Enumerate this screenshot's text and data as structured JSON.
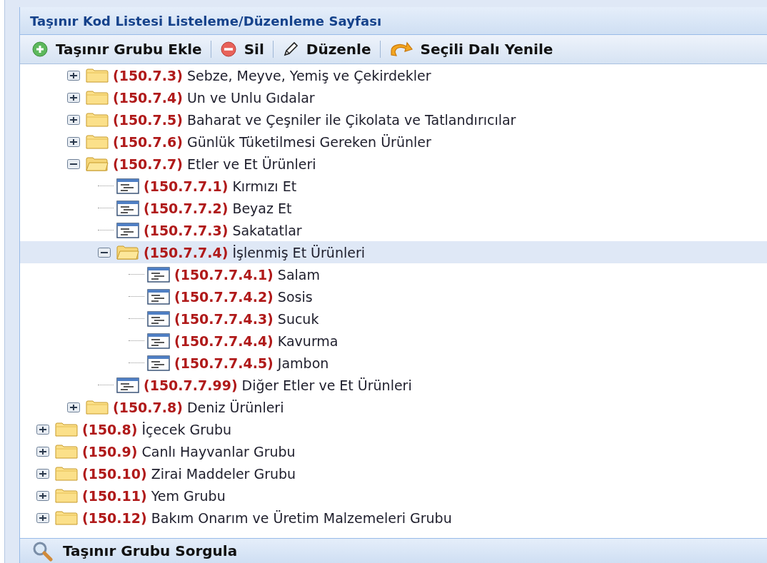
{
  "panel": {
    "title": "Taşınır Kod Listesi Listeleme/Düzenleme Sayfası"
  },
  "toolbar": [
    {
      "kind": "add",
      "label": "Taşınır Grubu Ekle"
    },
    {
      "kind": "delete",
      "label": "Sil"
    },
    {
      "kind": "edit",
      "label": "Düzenle"
    },
    {
      "kind": "refresh",
      "label": "Seçili Dalı Yenile"
    }
  ],
  "tree": {
    "items": [
      {
        "children": [
          {
            "kind": "folder",
            "code": "(150.7.3)",
            "label": "Sebze, Meyve, Yemiş ve Çekirdekler",
            "expanded": false,
            "selected": false
          },
          {
            "kind": "folder",
            "code": "(150.7.4)",
            "label": "Un ve Unlu Gıdalar",
            "expanded": false,
            "selected": false
          },
          {
            "kind": "folder",
            "code": "(150.7.5)",
            "label": "Baharat ve Çeşniler ile Çikolata ve Tatlandırıcılar",
            "expanded": false,
            "selected": false
          },
          {
            "kind": "folder",
            "code": "(150.7.6)",
            "label": "Günlük Tüketilmesi Gereken Ürünler",
            "expanded": false,
            "selected": false
          },
          {
            "kind": "folder",
            "code": "(150.7.7)",
            "label": "Etler ve Et Ürünleri",
            "expanded": true,
            "selected": false,
            "children": [
              {
                "kind": "leaf",
                "code": "(150.7.7.1)",
                "label": "Kırmızı Et",
                "selected": false
              },
              {
                "kind": "leaf",
                "code": "(150.7.7.2)",
                "label": "Beyaz Et",
                "selected": false
              },
              {
                "kind": "leaf",
                "code": "(150.7.7.3)",
                "label": "Sakatatlar",
                "selected": false
              },
              {
                "kind": "folder",
                "code": "(150.7.7.4)",
                "label": "İşlenmiş Et Ürünleri",
                "expanded": true,
                "selected": true,
                "children": [
                  {
                    "kind": "leaf",
                    "code": "(150.7.7.4.1)",
                    "label": "Salam",
                    "selected": false
                  },
                  {
                    "kind": "leaf",
                    "code": "(150.7.7.4.2)",
                    "label": "Sosis",
                    "selected": false
                  },
                  {
                    "kind": "leaf",
                    "code": "(150.7.7.4.3)",
                    "label": "Sucuk",
                    "selected": false
                  },
                  {
                    "kind": "leaf",
                    "code": "(150.7.7.4.4)",
                    "label": "Kavurma",
                    "selected": false
                  },
                  {
                    "kind": "leaf",
                    "code": "(150.7.7.4.5)",
                    "label": "Jambon",
                    "selected": false
                  }
                ]
              },
              {
                "kind": "leaf",
                "code": "(150.7.7.99)",
                "label": "Diğer Etler ve Et Ürünleri",
                "selected": false
              }
            ]
          },
          {
            "kind": "folder",
            "code": "(150.7.8)",
            "label": "Deniz Ürünleri",
            "expanded": false,
            "selected": false
          }
        ]
      },
      {
        "kind": "folder",
        "code": "(150.8)",
        "label": "İçecek Grubu",
        "expanded": false,
        "selected": false
      },
      {
        "kind": "folder",
        "code": "(150.9)",
        "label": "Canlı Hayvanlar Grubu",
        "expanded": false,
        "selected": false
      },
      {
        "kind": "folder",
        "code": "(150.10)",
        "label": "Zirai Maddeler Grubu",
        "expanded": false,
        "selected": false
      },
      {
        "kind": "folder",
        "code": "(150.11)",
        "label": "Yem Grubu",
        "expanded": false,
        "selected": false
      },
      {
        "kind": "folder",
        "code": "(150.12)",
        "label": "Bakım Onarım ve Üretim Malzemeleri Grubu",
        "expanded": false,
        "selected": false
      }
    ]
  },
  "query_panel": {
    "title": "Taşınır Grubu Sorgula"
  }
}
